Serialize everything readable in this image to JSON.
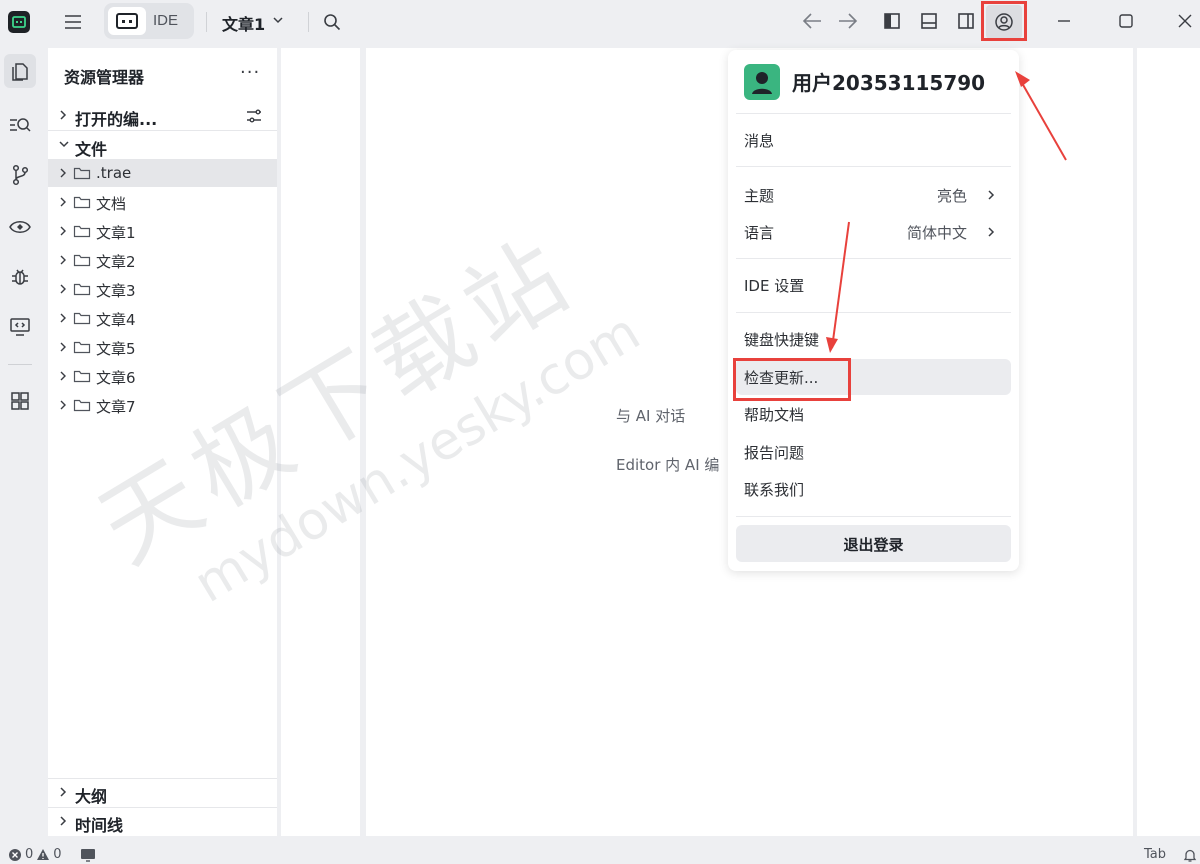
{
  "titlebar": {
    "mode_label": "IDE",
    "project_name": "文章1"
  },
  "explorer": {
    "title": "资源管理器",
    "more": "···",
    "open_editors_label": "打开的编...",
    "files_label": "文件",
    "tree": [
      {
        "label": ".trae",
        "active": true
      },
      {
        "label": "文档"
      },
      {
        "label": "文章1"
      },
      {
        "label": "文章2"
      },
      {
        "label": "文章3"
      },
      {
        "label": "文章4"
      },
      {
        "label": "文章5"
      },
      {
        "label": "文章6"
      },
      {
        "label": "文章7"
      }
    ],
    "outline_label": "大纲",
    "timeline_label": "时间线"
  },
  "editor": {
    "chat_hint": "与 AI 对话",
    "editor_hint": "Editor 内 AI 编"
  },
  "account_menu": {
    "user_name": "用户20353115790",
    "messages": "消息",
    "theme_label": "主题",
    "theme_value": "亮色",
    "language_label": "语言",
    "language_value": "简体中文",
    "ide_settings": "IDE 设置",
    "shortcuts": "键盘快捷键",
    "check_updates": "检查更新...",
    "help_docs": "帮助文档",
    "report_issue": "报告问题",
    "contact_us": "联系我们",
    "logout": "退出登录"
  },
  "watermark": {
    "cn": "天极下载站",
    "url": "mydown.yesky.com"
  },
  "statusbar": {
    "errors": "0",
    "warnings": "0",
    "tab_label": "Tab"
  },
  "colors": {
    "highlight": "#e8413c",
    "avatar": "#3ab580"
  }
}
